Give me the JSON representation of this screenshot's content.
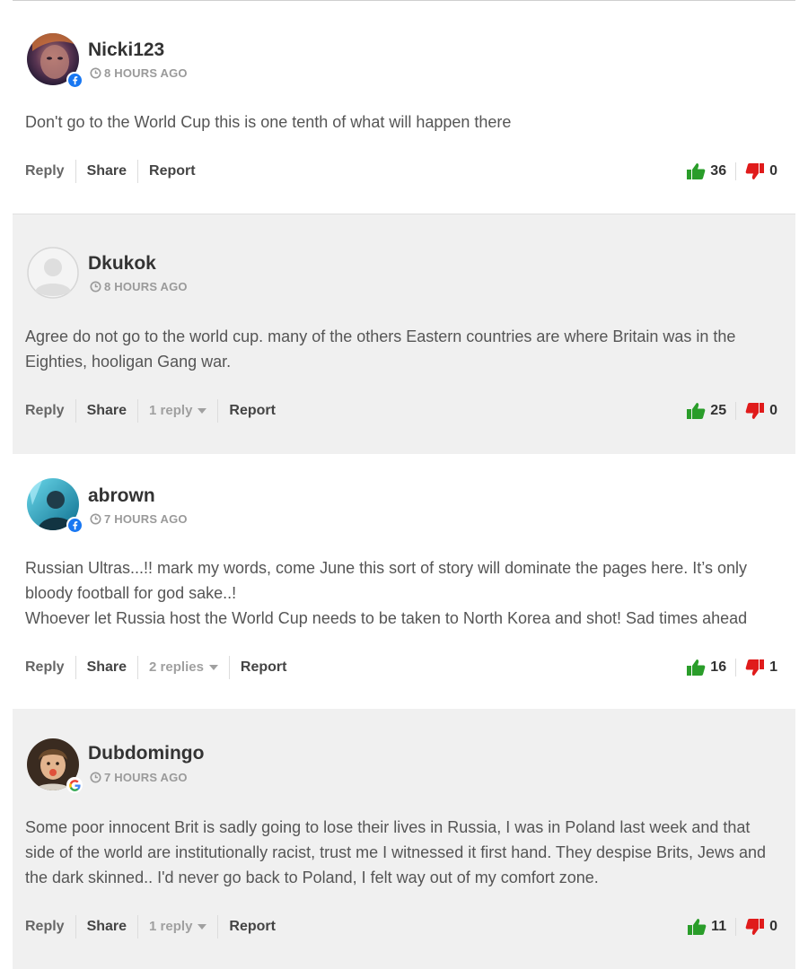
{
  "labels": {
    "reply": "Reply",
    "share": "Share",
    "report": "Report"
  },
  "colors": {
    "up": "#2a9d2a",
    "down": "#e01b1b",
    "facebook": "#1877f2"
  },
  "comments": [
    {
      "username": "Nicki123",
      "time": "8 HOURS AGO",
      "badge": "facebook-icon",
      "lines": [
        "Don't go to the World Cup this is one tenth of what will happen there"
      ],
      "replies": "",
      "up": "36",
      "down": "0"
    },
    {
      "username": "Dkukok",
      "time": "8 HOURS AGO",
      "badge": "",
      "lines": [
        "Agree do not go to the world cup. many of the others Eastern countries are where Britain was in the Eighties, hooligan Gang war."
      ],
      "replies": "1 reply",
      "up": "25",
      "down": "0"
    },
    {
      "username": "abrown",
      "time": "7 HOURS AGO",
      "badge": "facebook-icon",
      "lines": [
        "Russian Ultras...!! mark my words, come June this sort of story will dominate the pages here. It’s only bloody football for god sake..!",
        "Whoever let Russia host the World Cup needs to be taken to North Korea and shot! Sad times ahead"
      ],
      "replies": "2 replies",
      "up": "16",
      "down": "1"
    },
    {
      "username": "Dubdomingo",
      "time": "7 HOURS AGO",
      "badge": "google-icon",
      "lines": [
        "Some poor innocent Brit is sadly going to lose their lives in Russia, I was in Poland last week and that side of the world are institutionally racist, trust me I witnessed it first hand. They despise Brits, Jews and the dark skinned.. I'd never go back to Poland, I felt way out of my comfort zone."
      ],
      "replies": "1 reply",
      "up": "11",
      "down": "0"
    }
  ]
}
